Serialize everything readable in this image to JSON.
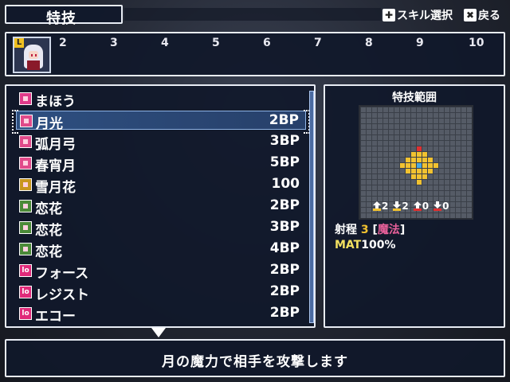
{
  "header": {
    "title": "特技",
    "skill_select_label": "スキル選択",
    "back_label": "戻る",
    "skill_select_icon": "dpad-icon",
    "back_icon": "x-button-icon"
  },
  "party": {
    "active_badge": "L",
    "slots": [
      "2",
      "3",
      "4",
      "5",
      "6",
      "7",
      "8",
      "9",
      "10"
    ]
  },
  "skills": [
    {
      "name": "まほう",
      "cost": "",
      "icon": "category",
      "selected": false
    },
    {
      "name": "月光",
      "cost": "2BP",
      "icon": "pink",
      "selected": true
    },
    {
      "name": "弧月弓",
      "cost": "3BP",
      "icon": "pink",
      "selected": false
    },
    {
      "name": "春宵月",
      "cost": "5BP",
      "icon": "pink",
      "selected": false
    },
    {
      "name": "雪月花",
      "cost": "100",
      "icon": "gold",
      "selected": false
    },
    {
      "name": "恋花",
      "cost": "2BP",
      "icon": "green",
      "selected": false
    },
    {
      "name": "恋花",
      "cost": "3BP",
      "icon": "green",
      "selected": false
    },
    {
      "name": "恋花",
      "cost": "4BP",
      "icon": "green",
      "selected": false
    },
    {
      "name": "フォース",
      "cost": "2BP",
      "icon": "lo",
      "selected": false
    },
    {
      "name": "レジスト",
      "cost": "2BP",
      "icon": "lo",
      "selected": false
    },
    {
      "name": "エコー",
      "cost": "2BP",
      "icon": "lo",
      "selected": false
    }
  ],
  "skill_icon_lo_text": "lo",
  "range_panel": {
    "title": "特技範囲",
    "stats": [
      "2",
      "2",
      "0",
      "0"
    ],
    "range_label": "射程",
    "range_value": "3",
    "range_type_open": "[",
    "range_type": "魔法",
    "range_type_close": "]",
    "mat_label": "MAT",
    "mat_value": "100%"
  },
  "colors": {
    "range_yellow": "#f2c230",
    "range_center": "#4aa8e0",
    "range_top": "#e03030",
    "accent_pink": "#e8609a"
  },
  "message": "月の魔力で相手を攻撃します"
}
